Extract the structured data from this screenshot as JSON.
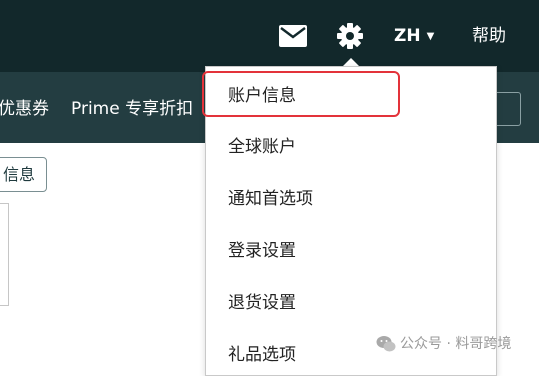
{
  "header": {
    "language": "ZH",
    "help": "帮助",
    "icons": [
      "mail-icon",
      "gear-icon",
      "chevron-down-icon"
    ]
  },
  "nav": {
    "items": [
      "优惠券",
      "Prime 专享折扣"
    ]
  },
  "dropdown": {
    "items": [
      "账户信息",
      "全球账户",
      "通知首选项",
      "登录设置",
      "退货设置",
      "礼品选项"
    ],
    "highlighted_item": "账户信息"
  },
  "left_panel": {
    "button_label": "信息"
  },
  "watermark": {
    "text": "公众号 · 料哥跨境"
  },
  "colors": {
    "top_bar": "#12282b",
    "nav_bar": "#233d41",
    "highlight_border": "#e3323a"
  }
}
